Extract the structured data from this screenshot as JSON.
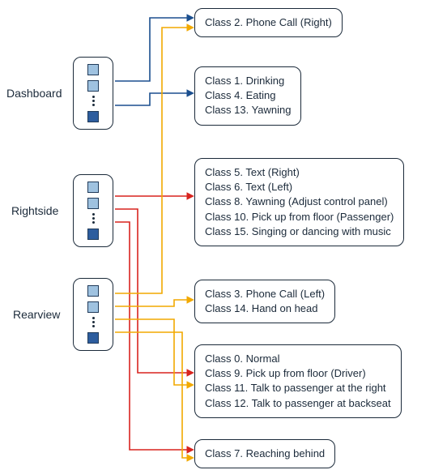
{
  "sources": {
    "dashboard": {
      "label": "Dashboard"
    },
    "rightside": {
      "label": "Rightside"
    },
    "rearview": {
      "label": "Rearview"
    }
  },
  "boxes": {
    "b1": {
      "lines": [
        "Class 2. Phone Call (Right)"
      ]
    },
    "b2": {
      "lines": [
        "Class 1. Drinking",
        "Class 4. Eating",
        "Class 13. Yawning"
      ]
    },
    "b3": {
      "lines": [
        "Class 5. Text (Right)",
        "Class 6. Text (Left)",
        "Class 8. Yawning (Adjust control panel)",
        "Class 10. Pick up from floor (Passenger)",
        "Class 15. Singing  or dancing with music"
      ]
    },
    "b4": {
      "lines": [
        "Class 3. Phone Call (Left)",
        "Class 14. Hand on head"
      ]
    },
    "b5": {
      "lines": [
        "Class 0. Normal",
        "Class 9. Pick up from floor (Driver)",
        "Class 11. Talk to passenger at the right",
        "Class 12. Talk to passenger at backseat"
      ]
    },
    "b6": {
      "lines": [
        "Class 7. Reaching behind"
      ]
    }
  },
  "colors": {
    "dashboard": "#1b4f8f",
    "rightside": "#d8241f",
    "rearview": "#f2a900",
    "border": "#1b2a3a"
  }
}
